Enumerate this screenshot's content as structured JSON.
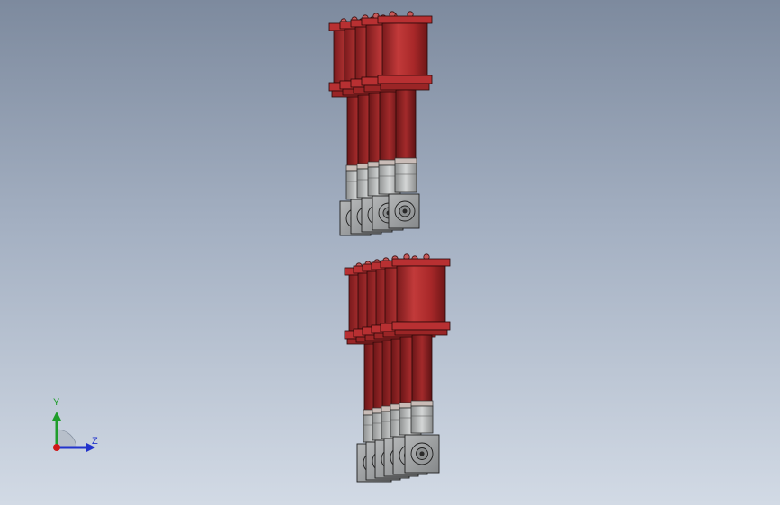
{
  "viewport": {
    "background_top": "#7d8a9e",
    "background_bottom": "#d2dae5"
  },
  "model": {
    "part_color": "#a8282a",
    "metal_color": "#b9bcbc",
    "gearbox_color": "#9a9c9d",
    "assemblies": [
      {
        "name": "upper-cylinder-stack",
        "units": 5
      },
      {
        "name": "lower-cylinder-stack",
        "units": 6
      }
    ]
  },
  "triad": {
    "y_label": "Y",
    "z_label": "Z",
    "y_color": "#1f9d2b",
    "z_color": "#2233cc",
    "x_color": "#d01818"
  }
}
